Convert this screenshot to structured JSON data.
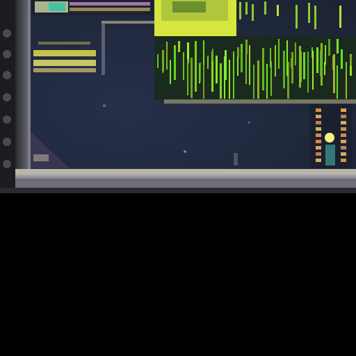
{
  "image": {
    "subject": "die-micrograph",
    "palette": {
      "die_surface": "#232b3d",
      "bond_ring": "#9a9aa6",
      "green_logic": "#7fd61e",
      "bright_yellow": "#e6ef2a",
      "lower_fill": "#000000"
    }
  }
}
